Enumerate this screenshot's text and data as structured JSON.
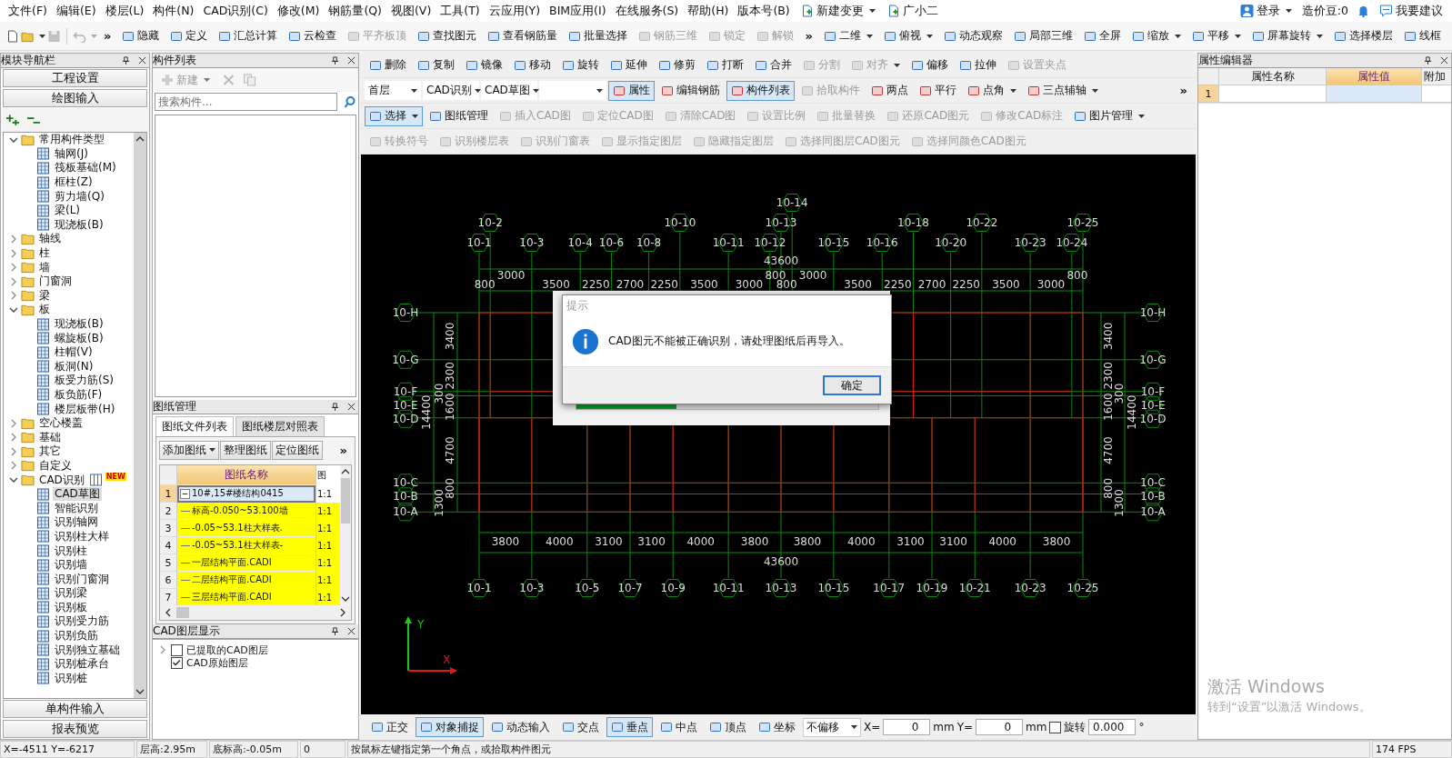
{
  "menu": [
    "文件(F)",
    "编辑(E)",
    "楼层(L)",
    "构件(N)",
    "CAD识别(C)",
    "修改(M)",
    "钢筋量(Q)",
    "视图(V)",
    "工具(T)",
    "云应用(Y)",
    "BIM应用(I)",
    "在线服务(S)",
    "帮助(H)",
    "版本号(B)"
  ],
  "menu_extras": [
    {
      "label": "新建变更",
      "dropdown": true
    },
    {
      "label": "广小二",
      "dropdown": false
    }
  ],
  "account": {
    "login": "登录",
    "beans": "造价豆:0",
    "feedback": "我要建议"
  },
  "main_toolbar": {
    "overflow": "»",
    "tools": [
      {
        "label": "隐藏",
        "disabled": false,
        "dropdown": false
      },
      {
        "label": "定义",
        "disabled": false,
        "dropdown": false
      },
      {
        "label": "汇总计算",
        "disabled": false,
        "dropdown": false
      },
      {
        "label": "云检查",
        "disabled": false,
        "dropdown": false
      },
      {
        "label": "平齐板顶",
        "disabled": true,
        "dropdown": false
      },
      {
        "label": "查找图元",
        "disabled": false,
        "dropdown": false
      },
      {
        "label": "查看钢筋量",
        "disabled": false,
        "dropdown": false
      },
      {
        "label": "批量选择",
        "disabled": false,
        "dropdown": false
      },
      {
        "label": "钢筋三维",
        "disabled": true,
        "dropdown": false
      },
      {
        "label": "锁定",
        "disabled": true,
        "dropdown": false
      },
      {
        "label": "解锁",
        "disabled": true,
        "dropdown": false
      }
    ],
    "view_overflow": "»",
    "view_tools": [
      {
        "label": "二维",
        "disabled": false,
        "dropdown": true
      },
      {
        "label": "俯视",
        "disabled": false,
        "dropdown": true
      },
      {
        "label": "动态观察",
        "disabled": false,
        "dropdown": false
      },
      {
        "label": "局部三维",
        "disabled": false,
        "dropdown": false
      },
      {
        "label": "全屏",
        "disabled": false,
        "dropdown": false
      },
      {
        "label": "缩放",
        "disabled": false,
        "dropdown": true
      },
      {
        "label": "平移",
        "disabled": false,
        "dropdown": true
      },
      {
        "label": "屏幕旋转",
        "disabled": false,
        "dropdown": true
      },
      {
        "label": "选择楼层",
        "disabled": false,
        "dropdown": false
      },
      {
        "label": "线框",
        "disabled": false,
        "dropdown": false
      }
    ]
  },
  "nav_panel": {
    "title": "模块导航栏",
    "top_buttons": [
      "工程设置",
      "绘图输入"
    ],
    "tree": [
      {
        "label": "常用构件类型",
        "kind": "folder",
        "expanded": true,
        "selected": false,
        "children": [
          {
            "label": "轴网(J)",
            "kind": "item",
            "selected": false
          },
          {
            "label": "筏板基础(M)",
            "kind": "item",
            "selected": false
          },
          {
            "label": "框柱(Z)",
            "kind": "item",
            "selected": false
          },
          {
            "label": "剪力墙(Q)",
            "kind": "item",
            "selected": false
          },
          {
            "label": "梁(L)",
            "kind": "item",
            "selected": false
          },
          {
            "label": "现浇板(B)",
            "kind": "item",
            "selected": false
          }
        ]
      },
      {
        "label": "轴线",
        "kind": "folder",
        "expanded": false,
        "selected": false
      },
      {
        "label": "柱",
        "kind": "folder",
        "expanded": false,
        "selected": false
      },
      {
        "label": "墙",
        "kind": "folder",
        "expanded": false,
        "selected": false
      },
      {
        "label": "门窗洞",
        "kind": "folder",
        "expanded": false,
        "selected": false
      },
      {
        "label": "梁",
        "kind": "folder",
        "expanded": false,
        "selected": false
      },
      {
        "label": "板",
        "kind": "folder",
        "expanded": true,
        "selected": false,
        "children": [
          {
            "label": "现浇板(B)",
            "kind": "item",
            "selected": false
          },
          {
            "label": "螺旋板(B)",
            "kind": "item",
            "selected": false
          },
          {
            "label": "柱帽(V)",
            "kind": "item",
            "selected": false
          },
          {
            "label": "板洞(N)",
            "kind": "item",
            "selected": false
          },
          {
            "label": "板受力筋(S)",
            "kind": "item",
            "selected": false
          },
          {
            "label": "板负筋(F)",
            "kind": "item",
            "selected": false
          },
          {
            "label": "楼层板带(H)",
            "kind": "item",
            "selected": false
          }
        ]
      },
      {
        "label": "空心楼盖",
        "kind": "folder",
        "expanded": false,
        "selected": false
      },
      {
        "label": "基础",
        "kind": "folder",
        "expanded": false,
        "selected": false
      },
      {
        "label": "其它",
        "kind": "folder",
        "expanded": false,
        "selected": false
      },
      {
        "label": "自定义",
        "kind": "folder",
        "expanded": false,
        "selected": false
      },
      {
        "label": "CAD识别",
        "kind": "folder",
        "expanded": true,
        "selected": false,
        "badge": "NEW",
        "children": [
          {
            "label": "CAD草图",
            "kind": "item",
            "selected": true
          },
          {
            "label": "智能识别",
            "kind": "item",
            "selected": false
          },
          {
            "label": "识别轴网",
            "kind": "item",
            "selected": false
          },
          {
            "label": "识别柱大样",
            "kind": "item",
            "selected": false
          },
          {
            "label": "识别柱",
            "kind": "item",
            "selected": false
          },
          {
            "label": "识别墙",
            "kind": "item",
            "selected": false
          },
          {
            "label": "识别门窗洞",
            "kind": "item",
            "selected": false
          },
          {
            "label": "识别梁",
            "kind": "item",
            "selected": false
          },
          {
            "label": "识别板",
            "kind": "item",
            "selected": false
          },
          {
            "label": "识别受力筋",
            "kind": "item",
            "selected": false
          },
          {
            "label": "识别负筋",
            "kind": "item",
            "selected": false
          },
          {
            "label": "识别独立基础",
            "kind": "item",
            "selected": false
          },
          {
            "label": "识别桩承台",
            "kind": "item",
            "selected": false
          },
          {
            "label": "识别桩",
            "kind": "item",
            "selected": false
          }
        ]
      }
    ],
    "bottom_buttons": [
      "单构件输入",
      "报表预览"
    ]
  },
  "component_list": {
    "title": "构件列表",
    "new_button": {
      "label": "新建",
      "disabled": true
    },
    "search": {
      "placeholder": "搜索构件..."
    }
  },
  "drawing_manager": {
    "title": "图纸管理",
    "tabs": [
      {
        "label": "图纸文件列表",
        "selected": true
      },
      {
        "label": "图纸楼层对照表",
        "selected": false
      }
    ],
    "buttons": [
      {
        "label": "添加图纸",
        "dropdown": true
      },
      {
        "label": "整理图纸",
        "dropdown": false
      },
      {
        "label": "定位图纸",
        "dropdown": false
      }
    ],
    "overflow": "»",
    "columns": [
      "图纸名称",
      "图"
    ],
    "rows": [
      {
        "no": "1",
        "name": "10#,15#楼结构0415",
        "scale": "1:1",
        "kind": "file",
        "selected": true
      },
      {
        "no": "2",
        "name": "标高-0.050~53.100墙",
        "scale": "1:1",
        "kind": "drawing",
        "selected": false
      },
      {
        "no": "3",
        "name": "-0.05~53.1柱大样表.",
        "scale": "1:1",
        "kind": "drawing",
        "selected": false
      },
      {
        "no": "4",
        "name": "-0.05~53.1柱大样表-",
        "scale": "1:1",
        "kind": "drawing",
        "selected": false
      },
      {
        "no": "5",
        "name": "一层结构平面.CADI",
        "scale": "1:1",
        "kind": "drawing",
        "selected": false
      },
      {
        "no": "6",
        "name": "二层结构平面.CADI",
        "scale": "1:1",
        "kind": "drawing",
        "selected": false
      },
      {
        "no": "7",
        "name": "三层结构平面.CADI",
        "scale": "1:1",
        "kind": "drawing",
        "selected": false
      }
    ]
  },
  "cad_layers": {
    "title": "CAD图层显示",
    "layers": [
      {
        "label": "已提取的CAD图层",
        "checked": false,
        "expanded": false
      },
      {
        "label": "CAD原始图层",
        "checked": true
      }
    ]
  },
  "edit_toolbar": [
    {
      "label": "删除",
      "disabled": false,
      "dropdown": false
    },
    {
      "label": "复制",
      "disabled": false,
      "dropdown": false
    },
    {
      "label": "镜像",
      "disabled": false,
      "dropdown": false
    },
    {
      "label": "移动",
      "disabled": false,
      "dropdown": false
    },
    {
      "label": "旋转",
      "disabled": false,
      "dropdown": false
    },
    {
      "label": "延伸",
      "disabled": false,
      "dropdown": false
    },
    {
      "label": "修剪",
      "disabled": false,
      "dropdown": false
    },
    {
      "label": "打断",
      "disabled": false,
      "dropdown": false
    },
    {
      "label": "合并",
      "disabled": false,
      "dropdown": false
    },
    {
      "label": "分割",
      "disabled": true,
      "dropdown": false
    },
    {
      "label": "对齐",
      "disabled": true,
      "dropdown": true
    },
    {
      "label": "偏移",
      "disabled": false,
      "dropdown": false
    },
    {
      "label": "拉伸",
      "disabled": false,
      "dropdown": false
    },
    {
      "label": "设置夹点",
      "disabled": true,
      "dropdown": false
    }
  ],
  "layer_toolbar": {
    "combos": [
      "首层",
      "CAD识别",
      "CAD草图"
    ],
    "overflow": "»",
    "tools": [
      {
        "label": "属性",
        "disabled": false,
        "dropdown": false,
        "pressed": true
      },
      {
        "label": "编辑钢筋",
        "disabled": false,
        "dropdown": false,
        "pressed": false
      },
      {
        "label": "构件列表",
        "disabled": false,
        "dropdown": false,
        "pressed": true
      },
      {
        "label": "拾取构件",
        "disabled": true,
        "dropdown": false,
        "pressed": false
      },
      {
        "label": "两点",
        "disabled": false,
        "dropdown": false,
        "pressed": false
      },
      {
        "label": "平行",
        "disabled": false,
        "dropdown": false,
        "pressed": false
      },
      {
        "label": "点角",
        "disabled": false,
        "dropdown": true,
        "pressed": false
      },
      {
        "label": "三点辅轴",
        "disabled": false,
        "dropdown": true,
        "pressed": false
      }
    ]
  },
  "cad_toolbar": [
    {
      "label": "选择",
      "disabled": false,
      "dropdown": true,
      "pressed": true
    },
    {
      "label": "图纸管理",
      "disabled": false,
      "dropdown": false,
      "pressed": false
    },
    {
      "label": "插入CAD图",
      "disabled": true,
      "dropdown": false,
      "pressed": false
    },
    {
      "label": "定位CAD图",
      "disabled": true,
      "dropdown": false,
      "pressed": false
    },
    {
      "label": "清除CAD图",
      "disabled": true,
      "dropdown": false,
      "pressed": false
    },
    {
      "label": "设置比例",
      "disabled": true,
      "dropdown": false,
      "pressed": false
    },
    {
      "label": "批量替换",
      "disabled": true,
      "dropdown": false,
      "pressed": false
    },
    {
      "label": "还原CAD图元",
      "disabled": true,
      "dropdown": false,
      "pressed": false
    },
    {
      "label": "修改CAD标注",
      "disabled": true,
      "dropdown": false,
      "pressed": false
    },
    {
      "label": "图片管理",
      "disabled": false,
      "dropdown": true,
      "pressed": false
    }
  ],
  "layer_tools": [
    {
      "label": "转换符号",
      "disabled": true
    },
    {
      "label": "识别楼层表",
      "disabled": true
    },
    {
      "label": "识别门窗表",
      "disabled": true
    },
    {
      "label": "显示指定图层",
      "disabled": true
    },
    {
      "label": "隐藏指定图层",
      "disabled": true
    },
    {
      "label": "选择同图层CAD图元",
      "disabled": true
    },
    {
      "label": "选择同颜色CAD图元",
      "disabled": true
    }
  ],
  "plan": {
    "top_axes": [
      "10-1",
      "10-2",
      "10-3",
      "10-4",
      "10-6",
      "10-8",
      "10-10",
      "10-11",
      "10-12",
      "10-13",
      "10-14",
      "10-15",
      "10-16",
      "10-18",
      "10-20",
      "10-22",
      "10-23",
      "10-24",
      "10-25"
    ],
    "top_total": "43600",
    "top_dims": [
      "800",
      "3000",
      "3500",
      "2250",
      "2700",
      "2250",
      "3500",
      "3000",
      "800",
      "800",
      "3000",
      "3500",
      "2250",
      "2700",
      "2250",
      "3500",
      "3000",
      "800"
    ],
    "left_axes": [
      "10-H",
      "10-G",
      "10-F",
      "10-E",
      "10-D",
      "10-C",
      "10-B",
      "10-A"
    ],
    "left_dims": [
      "3400",
      "2300",
      "300",
      "1600",
      "4700",
      "800",
      "1300"
    ],
    "left_total": "14400",
    "right_axes": [
      "10-H",
      "10-G",
      "10-F",
      "10-E",
      "10-D",
      "10-C",
      "10-B",
      "10-A"
    ],
    "right_dims": [
      "3400",
      "2300",
      "300",
      "1600",
      "4700",
      "800",
      "1300"
    ],
    "right_total": "14400",
    "bottom_dims": [
      "3800",
      "4000",
      "3100",
      "3100",
      "4000",
      "3800",
      "3800",
      "4000",
      "3100",
      "3100",
      "4000",
      "3800"
    ],
    "bottom_total": "43600",
    "bottom_axes": [
      "10-1",
      "10-3",
      "10-5",
      "10-7",
      "10-9",
      "10-11",
      "10-13",
      "10-15",
      "10-17",
      "10-19",
      "10-21",
      "10-23",
      "10-25"
    ],
    "ucs": {
      "x": "X",
      "y": "Y"
    }
  },
  "dialog_progress": {
    "level": 0.33
  },
  "dialog": {
    "title": "提示",
    "message": "CAD图元不能被正确识别，请处理图纸后再导入。",
    "button": "确定"
  },
  "snap_toolbar": {
    "tools": [
      {
        "label": "正交",
        "pressed": false
      },
      {
        "label": "对象捕捉",
        "pressed": true
      },
      {
        "label": "动态输入",
        "pressed": false
      },
      {
        "label": "交点",
        "pressed": false
      },
      {
        "label": "垂点",
        "pressed": true
      },
      {
        "label": "中点",
        "pressed": false
      },
      {
        "label": "顶点",
        "pressed": false
      },
      {
        "label": "坐标",
        "pressed": false
      }
    ],
    "offset": "不偏移",
    "x": {
      "label": "X=",
      "value": "0",
      "unit": "mm"
    },
    "y": {
      "label": "Y=",
      "value": "0",
      "unit": "mm"
    },
    "lock": {
      "checked": false
    },
    "rotate": {
      "label": "旋转",
      "value": "0.000",
      "unit": "°"
    }
  },
  "properties": {
    "title": "属性编辑器",
    "columns": [
      "属性名称",
      "属性值",
      "附加"
    ],
    "rows": [
      {
        "no": "1"
      }
    ]
  },
  "watermark": {
    "title": "激活 Windows",
    "hint": "转到“设置”以激活 Windows。"
  },
  "status_bar": {
    "coords": "X=-4511 Y=-6217",
    "floor_height": "层高:2.95m",
    "base_elevation": "底标高:-0.05m",
    "field_4": "0",
    "prompt": "按鼠标左键指定第一个角点，或拾取构件图元",
    "fps": "174 FPS"
  }
}
